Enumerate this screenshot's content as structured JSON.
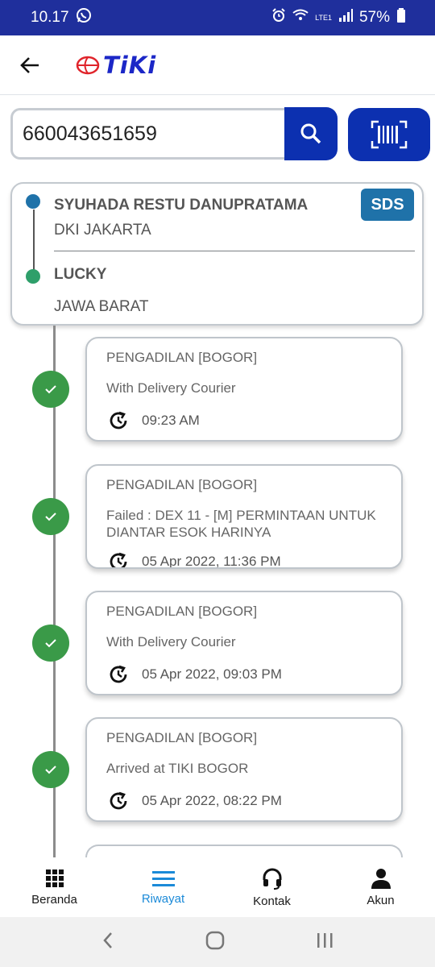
{
  "status_bar": {
    "time": "10.17",
    "battery": "57%",
    "network": "LTE1"
  },
  "app": {
    "brand": "TiKi"
  },
  "search": {
    "value": "660043651659"
  },
  "route": {
    "sender": {
      "name": "SYUHADA RESTU DANUPRATAMA",
      "region": "DKI JAKARTA"
    },
    "receiver": {
      "name": "LUCKY",
      "region": "JAWA BARAT"
    },
    "service_badge": "SDS"
  },
  "events": [
    {
      "location": "PENGADILAN [BOGOR]",
      "status": "With Delivery Courier",
      "time": "09:23 AM"
    },
    {
      "location": "PENGADILAN [BOGOR]",
      "status": "Failed : DEX 11 - [M] PERMINTAAN UNTUK DIANTAR ESOK HARINYA",
      "time": "05 Apr 2022, 11:36 PM"
    },
    {
      "location": "PENGADILAN [BOGOR]",
      "status": "With Delivery Courier",
      "time": "05 Apr 2022, 09:03 PM"
    },
    {
      "location": "PENGADILAN [BOGOR]",
      "status": "Arrived at TIKI BOGOR",
      "time": "05 Apr 2022, 08:22 PM"
    }
  ],
  "bottom_nav": [
    {
      "label": "Beranda",
      "icon": "grid-icon"
    },
    {
      "label": "Riwayat",
      "icon": "menu-icon",
      "active": true
    },
    {
      "label": "Kontak",
      "icon": "headset-icon"
    },
    {
      "label": "Akun",
      "icon": "person-icon"
    }
  ],
  "colors": {
    "primary": "#0c30b0",
    "status_bar": "#1f2f9c",
    "success": "#3a9a48",
    "active_nav": "#1b8ad8",
    "badge": "#1f72a9"
  }
}
